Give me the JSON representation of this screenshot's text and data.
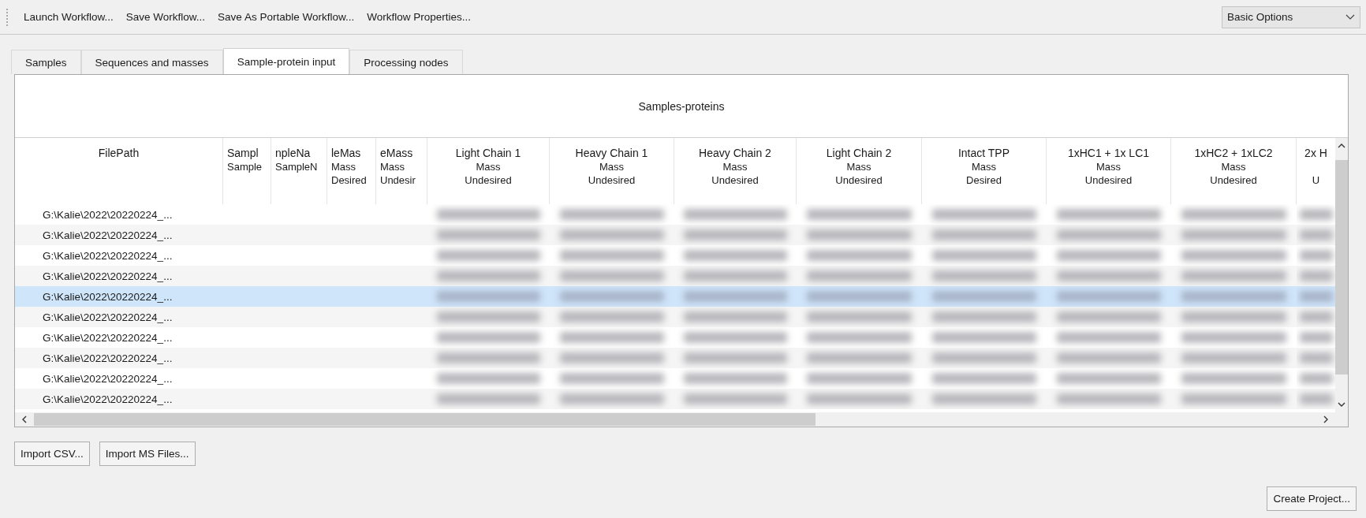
{
  "toolbar": {
    "actions": [
      "Launch Workflow...",
      "Save Workflow...",
      "Save As Portable Workflow...",
      "Workflow Properties..."
    ],
    "mode_dropdown": {
      "value": "Basic Options"
    }
  },
  "tabs": [
    {
      "label": "Samples",
      "selected": false
    },
    {
      "label": "Sequences and masses",
      "selected": false
    },
    {
      "label": "Sample-protein input",
      "selected": true
    },
    {
      "label": "Processing nodes",
      "selected": false
    }
  ],
  "table": {
    "title": "Samples-proteins",
    "columns": [
      {
        "kind": "path",
        "title": "FilePath"
      },
      {
        "kind": "empty",
        "title": "Sampl",
        "line_2": "Sample"
      },
      {
        "kind": "empty",
        "title": "npleNa",
        "line_2": "SampleN"
      },
      {
        "kind": "empty",
        "title": "leMas",
        "line_2": "Mass",
        "line_3": "Desired"
      },
      {
        "kind": "empty",
        "title": "eMass",
        "line_2": "Mass",
        "line_3": "Undesir"
      },
      {
        "kind": "value",
        "title": "Light Chain 1",
        "line_2": "Mass",
        "line_3": "Undesired"
      },
      {
        "kind": "value",
        "title": "Heavy Chain 1",
        "line_2": "Mass",
        "line_3": "Undesired"
      },
      {
        "kind": "value",
        "title": "Heavy Chain 2",
        "line_2": "Mass",
        "line_3": "Undesired"
      },
      {
        "kind": "value",
        "title": "Light Chain 2",
        "line_2": "Mass",
        "line_3": "Undesired"
      },
      {
        "kind": "value",
        "title": "Intact TPP",
        "line_2": "Mass",
        "line_3": "Desired"
      },
      {
        "kind": "value",
        "title": "1xHC1 + 1x LC1",
        "line_2": "Mass",
        "line_3": "Undesired"
      },
      {
        "kind": "value",
        "title": "1xHC2 + 1xLC2",
        "line_2": "Mass",
        "line_3": "Undesired"
      },
      {
        "kind": "value",
        "title": "2x H",
        "line_3": "U"
      }
    ],
    "rows": [
      {
        "file_path": "G:\\Kalie\\2022\\20220224_...",
        "selected": false
      },
      {
        "file_path": "G:\\Kalie\\2022\\20220224_...",
        "selected": false
      },
      {
        "file_path": "G:\\Kalie\\2022\\20220224_...",
        "selected": false
      },
      {
        "file_path": "G:\\Kalie\\2022\\20220224_...",
        "selected": false
      },
      {
        "file_path": "G:\\Kalie\\2022\\20220224_...",
        "selected": true
      },
      {
        "file_path": "G:\\Kalie\\2022\\20220224_...",
        "selected": false
      },
      {
        "file_path": "G:\\Kalie\\2022\\20220224_...",
        "selected": false
      },
      {
        "file_path": "G:\\Kalie\\2022\\20220224_...",
        "selected": false
      },
      {
        "file_path": "G:\\Kalie\\2022\\20220224_...",
        "selected": false
      },
      {
        "file_path": "G:\\Kalie\\2022\\20220224_...",
        "selected": false
      }
    ]
  },
  "import_buttons": [
    "Import CSV...",
    "Import MS Files..."
  ],
  "footer_button": "Create Project..."
}
